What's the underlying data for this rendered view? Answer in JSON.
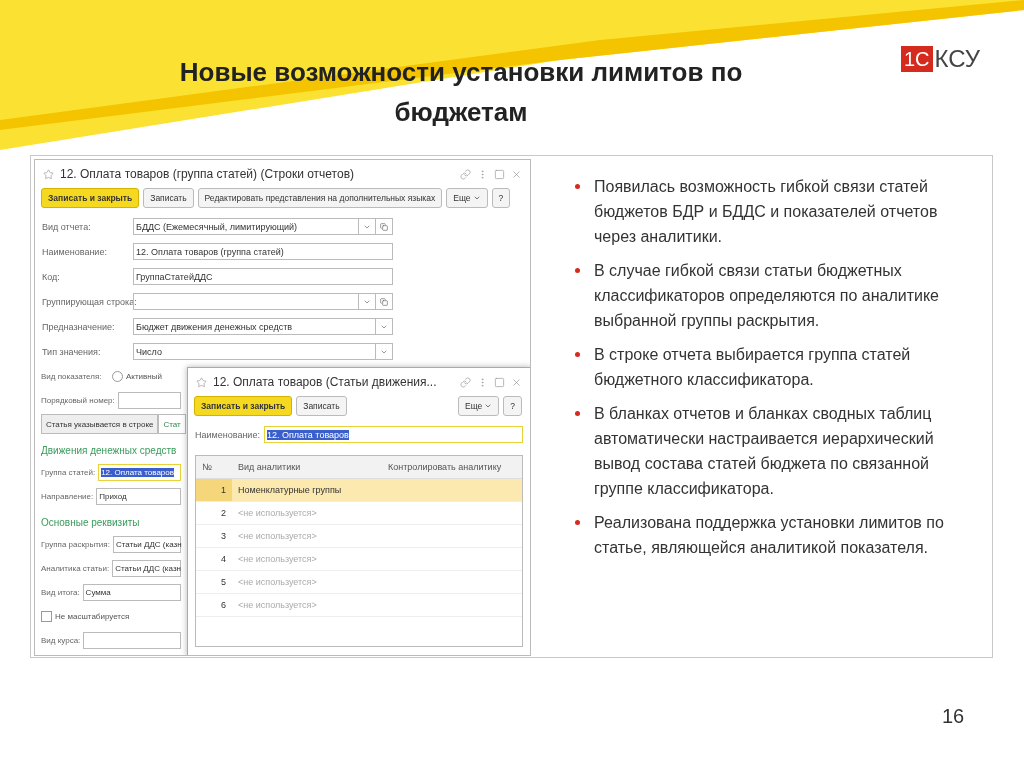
{
  "slide": {
    "title_lines": [
      "Новые возможности установки лимитов по",
      "бюджетам"
    ],
    "logo": {
      "mark": "1С",
      "text": "КСУ"
    },
    "bullets": [
      "Появилась возможность гибкой связи статей бюджетов БДР и БДДС и показателей отчетов через аналитики.",
      "В случае гибкой связи статьи бюджетных классификаторов определяются  по аналитике выбранной группы раскрытия.",
      "В строке отчета выбирается группа статей бюджетного классификатора.",
      "В бланках отчетов и бланках сводных таблиц автоматически настраивается иерархический вывод состава статей бюджета по связанной группе классификатора.",
      "Реализована поддержка установки лимитов по статье, являющейся аналитикой показателя."
    ],
    "page_number": "16"
  },
  "main_window": {
    "title": "12. Оплата товаров (группа статей) (Строки отчетов)",
    "buttons": [
      {
        "label": "Записать и закрыть",
        "kind": "primary"
      },
      {
        "label": "Записать",
        "kind": "normal"
      },
      {
        "label": "Редактировать представления на дополнительных языках",
        "kind": "normal"
      },
      {
        "label": "Еще",
        "kind": "menu"
      },
      {
        "label": "?",
        "kind": "help"
      }
    ],
    "fields": [
      {
        "label": "Вид отчета:",
        "value": "БДДС (Ежемесячный, лимитирующий)",
        "dropdown": true,
        "open": true
      },
      {
        "label": "Наименование:",
        "value": "12. Оплата товаров (группа статей)",
        "dropdown": false,
        "open": false
      },
      {
        "label": "Код:",
        "value": "ГруппаСтатейДДС",
        "dropdown": false,
        "open": false
      },
      {
        "label": "Группирующая строка:",
        "dropdown": true,
        "open": true
      },
      {
        "label": "Предназначение:",
        "value": "Бюджет движения денежных средств",
        "dropdown": true,
        "open": false
      },
      {
        "label": "Тип значения:",
        "value": "Число",
        "dropdown": true,
        "open": false
      }
    ],
    "lower": [
      {
        "kind": "radio",
        "label": "Вид показателя:",
        "option": "Активный",
        "selected": false
      },
      {
        "kind": "field",
        "label": "Порядковый номер:",
        "focused": false
      },
      {
        "kind": "tabs",
        "tabs": [
          {
            "label": "Статья указывается в строке",
            "selected": true
          },
          {
            "label": "Стат",
            "selected": false
          }
        ]
      },
      {
        "kind": "heading",
        "text": "Движения денежных средств"
      },
      {
        "kind": "field",
        "label": "Группа статей:",
        "value": "12. Оплата товаров",
        "focused": true
      },
      {
        "kind": "field",
        "label": "Направление:",
        "value": "Приход",
        "focused": false
      },
      {
        "kind": "heading",
        "text": "Основные реквизиты"
      },
      {
        "kind": "field",
        "label": "Группа раскрытия:",
        "value": "Статьи ДДС (казн",
        "focused": false
      },
      {
        "kind": "field",
        "label": "Аналитика статьи:",
        "value": "Статьи ДДС (казн",
        "focused": false
      },
      {
        "kind": "field",
        "label": "Вид итога:",
        "value": "Сумма",
        "focused": false
      },
      {
        "kind": "checkbox",
        "label": "Не масштабируется",
        "checked": false
      },
      {
        "kind": "field",
        "label": "Вид курса:",
        "focused": false
      }
    ]
  },
  "dialog": {
    "title": "12. Оплата товаров (Статьи движения...",
    "buttons": [
      {
        "label": "Записать и закрыть",
        "kind": "primary"
      },
      {
        "label": "Записать",
        "kind": "normal"
      },
      {
        "label": "Еще",
        "kind": "menu"
      },
      {
        "label": "?",
        "kind": "help"
      }
    ],
    "name_label": "Наименование:",
    "name_value": "12. Оплата товаров",
    "table": {
      "columns": [
        "№",
        "Вид аналитики",
        "Контролировать аналитику"
      ],
      "rows": [
        {
          "number": "1",
          "analytic": "Номенклатурные группы",
          "unused": false,
          "selected": true
        },
        {
          "number": "2",
          "analytic": "<не используется>",
          "unused": true,
          "selected": false
        },
        {
          "number": "3",
          "analytic": "<не используется>",
          "unused": true,
          "selected": false
        },
        {
          "number": "4",
          "analytic": "<не используется>",
          "unused": true,
          "selected": false
        },
        {
          "number": "5",
          "analytic": "<не используется>",
          "unused": true,
          "selected": false
        },
        {
          "number": "6",
          "analytic": "<не используется>",
          "unused": true,
          "selected": false
        }
      ]
    }
  }
}
